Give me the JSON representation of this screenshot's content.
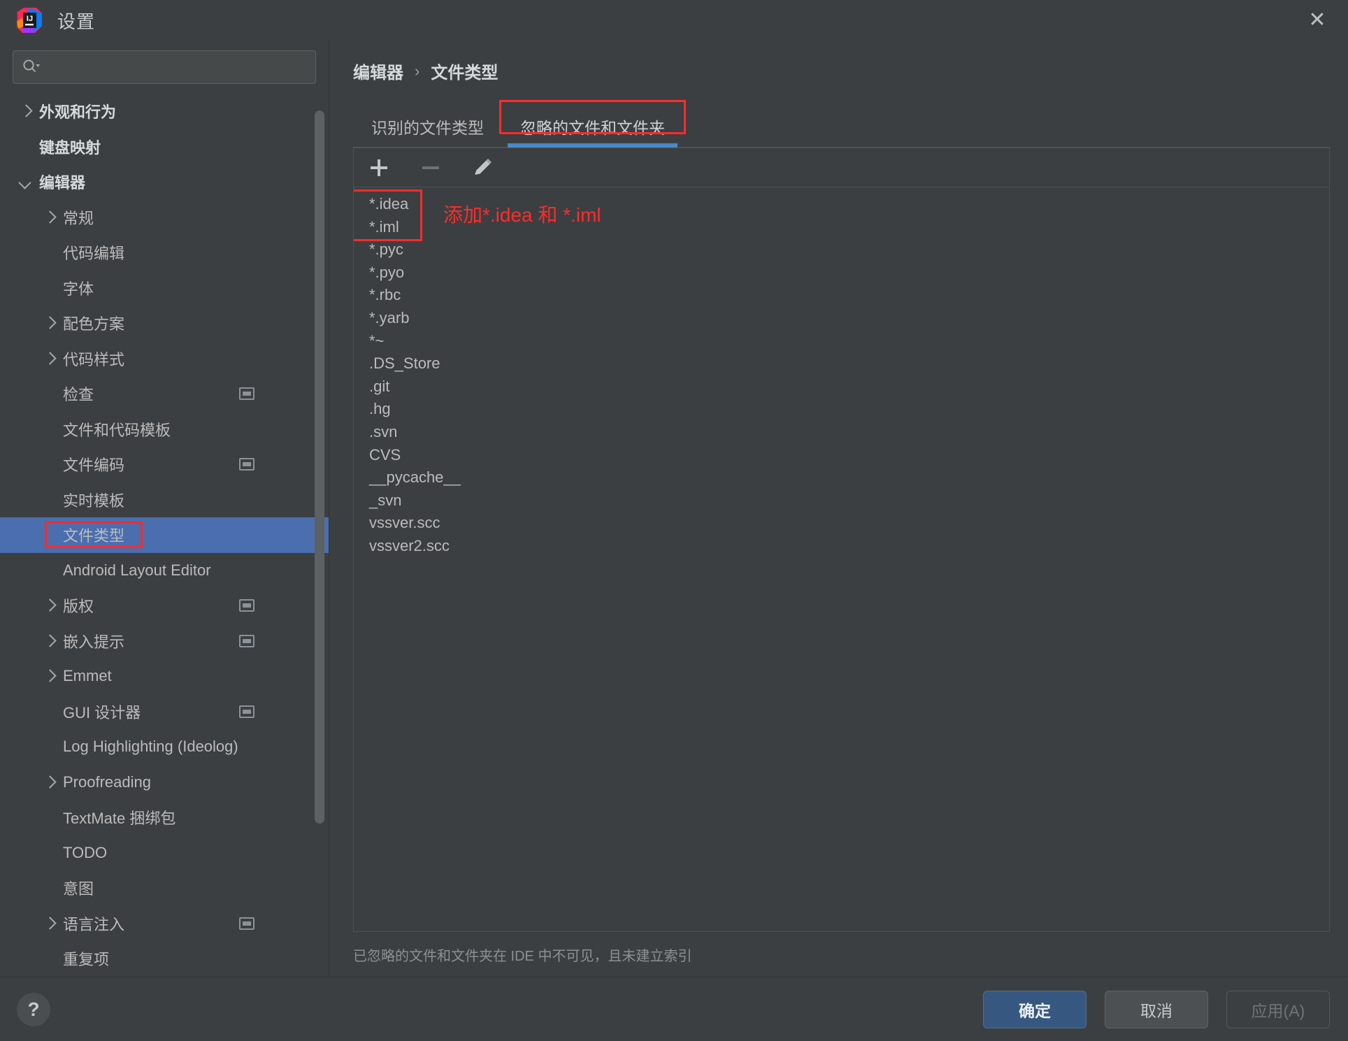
{
  "window": {
    "title": "设置",
    "close_icon": "close-icon",
    "logo_icon": "intellij-idea-logo"
  },
  "sidebar": {
    "search": {
      "placeholder": "",
      "value": "",
      "icon": "search-icon"
    },
    "items": [
      {
        "label": "外观和行为",
        "arrow": "right",
        "depth": 0,
        "bold": true,
        "selected": false,
        "badge": false
      },
      {
        "label": "键盘映射",
        "arrow": "none",
        "depth": 0,
        "bold": true,
        "selected": false,
        "badge": false
      },
      {
        "label": "编辑器",
        "arrow": "down",
        "depth": 0,
        "bold": true,
        "selected": false,
        "badge": false
      },
      {
        "label": "常规",
        "arrow": "right",
        "depth": 1,
        "bold": false,
        "selected": false,
        "badge": false
      },
      {
        "label": "代码编辑",
        "arrow": "none",
        "depth": 1,
        "bold": false,
        "selected": false,
        "badge": false
      },
      {
        "label": "字体",
        "arrow": "none",
        "depth": 1,
        "bold": false,
        "selected": false,
        "badge": false
      },
      {
        "label": "配色方案",
        "arrow": "right",
        "depth": 1,
        "bold": false,
        "selected": false,
        "badge": false
      },
      {
        "label": "代码样式",
        "arrow": "right",
        "depth": 1,
        "bold": false,
        "selected": false,
        "badge": false
      },
      {
        "label": "检查",
        "arrow": "none",
        "depth": 1,
        "bold": false,
        "selected": false,
        "badge": true
      },
      {
        "label": "文件和代码模板",
        "arrow": "none",
        "depth": 1,
        "bold": false,
        "selected": false,
        "badge": false
      },
      {
        "label": "文件编码",
        "arrow": "none",
        "depth": 1,
        "bold": false,
        "selected": false,
        "badge": true
      },
      {
        "label": "实时模板",
        "arrow": "none",
        "depth": 1,
        "bold": false,
        "selected": false,
        "badge": false
      },
      {
        "label": "文件类型",
        "arrow": "none",
        "depth": 1,
        "bold": false,
        "selected": true,
        "badge": false
      },
      {
        "label": "Android Layout Editor",
        "arrow": "none",
        "depth": 1,
        "bold": false,
        "selected": false,
        "badge": false
      },
      {
        "label": "版权",
        "arrow": "right",
        "depth": 1,
        "bold": false,
        "selected": false,
        "badge": true
      },
      {
        "label": "嵌入提示",
        "arrow": "right",
        "depth": 1,
        "bold": false,
        "selected": false,
        "badge": true
      },
      {
        "label": "Emmet",
        "arrow": "right",
        "depth": 1,
        "bold": false,
        "selected": false,
        "badge": false
      },
      {
        "label": "GUI 设计器",
        "arrow": "none",
        "depth": 1,
        "bold": false,
        "selected": false,
        "badge": true
      },
      {
        "label": "Log Highlighting (Ideolog)",
        "arrow": "none",
        "depth": 1,
        "bold": false,
        "selected": false,
        "badge": false
      },
      {
        "label": "Proofreading",
        "arrow": "right",
        "depth": 1,
        "bold": false,
        "selected": false,
        "badge": false
      },
      {
        "label": "TextMate 捆绑包",
        "arrow": "none",
        "depth": 1,
        "bold": false,
        "selected": false,
        "badge": false
      },
      {
        "label": "TODO",
        "arrow": "none",
        "depth": 1,
        "bold": false,
        "selected": false,
        "badge": false
      },
      {
        "label": "意图",
        "arrow": "none",
        "depth": 1,
        "bold": false,
        "selected": false,
        "badge": false
      },
      {
        "label": "语言注入",
        "arrow": "right",
        "depth": 1,
        "bold": false,
        "selected": false,
        "badge": true
      },
      {
        "label": "重复项",
        "arrow": "none",
        "depth": 1,
        "bold": false,
        "selected": false,
        "badge": false
      }
    ]
  },
  "main": {
    "breadcrumb": {
      "parent": "编辑器",
      "separator": "›",
      "current": "文件类型"
    },
    "tabs": [
      {
        "label": "识别的文件类型",
        "active": false
      },
      {
        "label": "忽略的文件和文件夹",
        "active": true
      }
    ],
    "toolbar": [
      {
        "name": "add-button",
        "icon": "plus-icon",
        "enabled": true
      },
      {
        "name": "remove-button",
        "icon": "minus-icon",
        "enabled": false
      },
      {
        "name": "edit-button",
        "icon": "pencil-icon",
        "enabled": true
      }
    ],
    "ignored_list": [
      "*.idea",
      "*.iml",
      "*.pyc",
      "*.pyo",
      "*.rbc",
      "*.yarb",
      "*~",
      ".DS_Store",
      ".git",
      ".hg",
      ".svn",
      "CVS",
      "__pycache__",
      "_svn",
      "vssver.scc",
      "vssver2.scc"
    ],
    "hint": "已忽略的文件和文件夹在 IDE 中不可见，且未建立索引"
  },
  "annotations": {
    "list_note": "添加*.idea 和 *.iml",
    "color": "#ff2b2b"
  },
  "footer": {
    "help_label": "?",
    "ok_label": "确定",
    "cancel_label": "取消",
    "apply_label": "应用(A)"
  },
  "colors": {
    "accent_blue": "#4a88c7",
    "selection_blue": "#4b6eaf",
    "primary_button": "#365880",
    "annotation_red": "#ff2b2b",
    "background": "#3c3f41"
  }
}
